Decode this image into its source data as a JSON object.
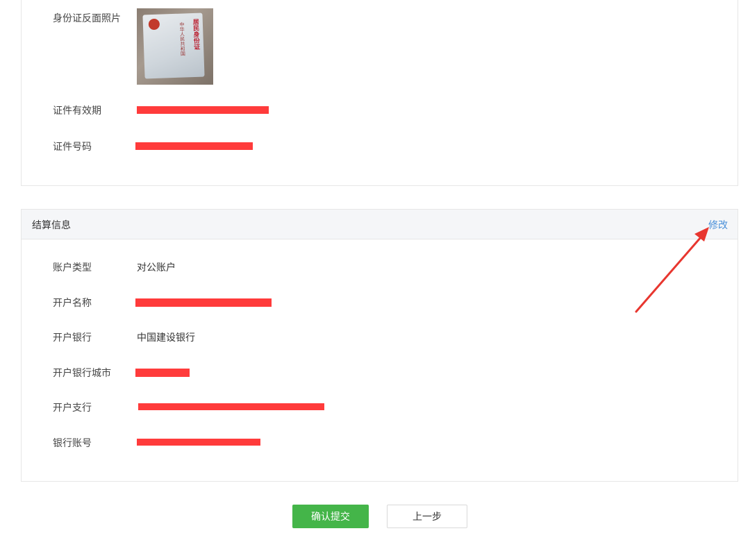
{
  "id_section": {
    "fields": [
      {
        "label": "身份证反面照片"
      },
      {
        "label": "证件有效期"
      },
      {
        "label": "证件号码"
      }
    ],
    "photo": {
      "card_title": "中华人民共和国",
      "card_subtitle": "居民身份证"
    }
  },
  "settlement": {
    "title": "结算信息",
    "edit_label": "修改",
    "fields": [
      {
        "label": "账户类型",
        "value": "对公账户"
      },
      {
        "label": "开户名称",
        "value": ""
      },
      {
        "label": "开户银行",
        "value": "中国建设银行"
      },
      {
        "label": "开户银行城市",
        "value": ""
      },
      {
        "label": "开户支行",
        "value": ""
      },
      {
        "label": "银行账号",
        "value": ""
      }
    ]
  },
  "buttons": {
    "confirm": "确认提交",
    "back": "上一步"
  },
  "colors": {
    "redaction": "#ff3b3b",
    "confirm_button": "#44b549",
    "link": "#4a90d9",
    "annotation_arrow": "#e8362f"
  }
}
